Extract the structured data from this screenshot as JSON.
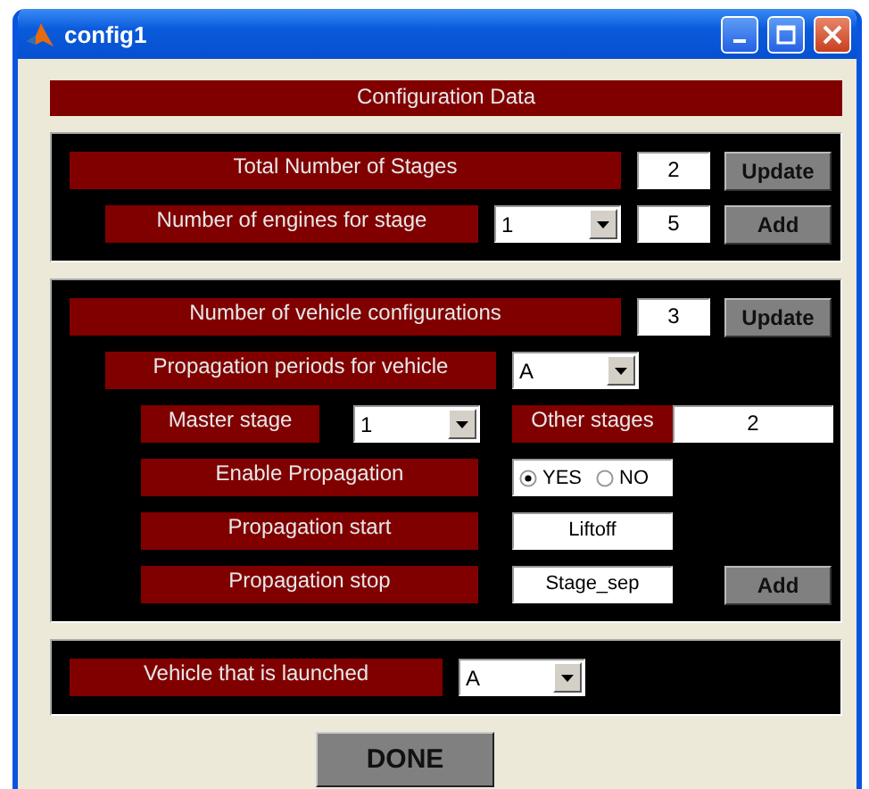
{
  "window": {
    "title": "config1"
  },
  "header": "Configuration Data",
  "stages_panel": {
    "total_stages": {
      "label": "Total Number of Stages",
      "value": "2",
      "button": "Update"
    },
    "engines": {
      "label": "Number of engines for stage",
      "stage": "1",
      "value": "5",
      "button": "Add"
    }
  },
  "vehicle_panel": {
    "configurations": {
      "label": "Number of vehicle configurations",
      "value": "3",
      "button": "Update"
    },
    "periods": {
      "label": "Propagation periods for vehicle",
      "value": "A"
    },
    "master_stage": {
      "label": "Master stage",
      "value": "1"
    },
    "other_stages": {
      "label": "Other stages",
      "value": "2"
    },
    "enable_propagation": {
      "label": "Enable Propagation",
      "options": [
        {
          "label": "YES",
          "selected": true
        },
        {
          "label": "NO",
          "selected": false
        }
      ]
    },
    "start": {
      "label": "Propagation start",
      "value": "Liftoff"
    },
    "stop": {
      "label": "Propagation stop",
      "value": "Stage_sep",
      "button": "Add"
    }
  },
  "launch": {
    "label": "Vehicle that is launched",
    "value": "A"
  },
  "done_button": "DONE"
}
